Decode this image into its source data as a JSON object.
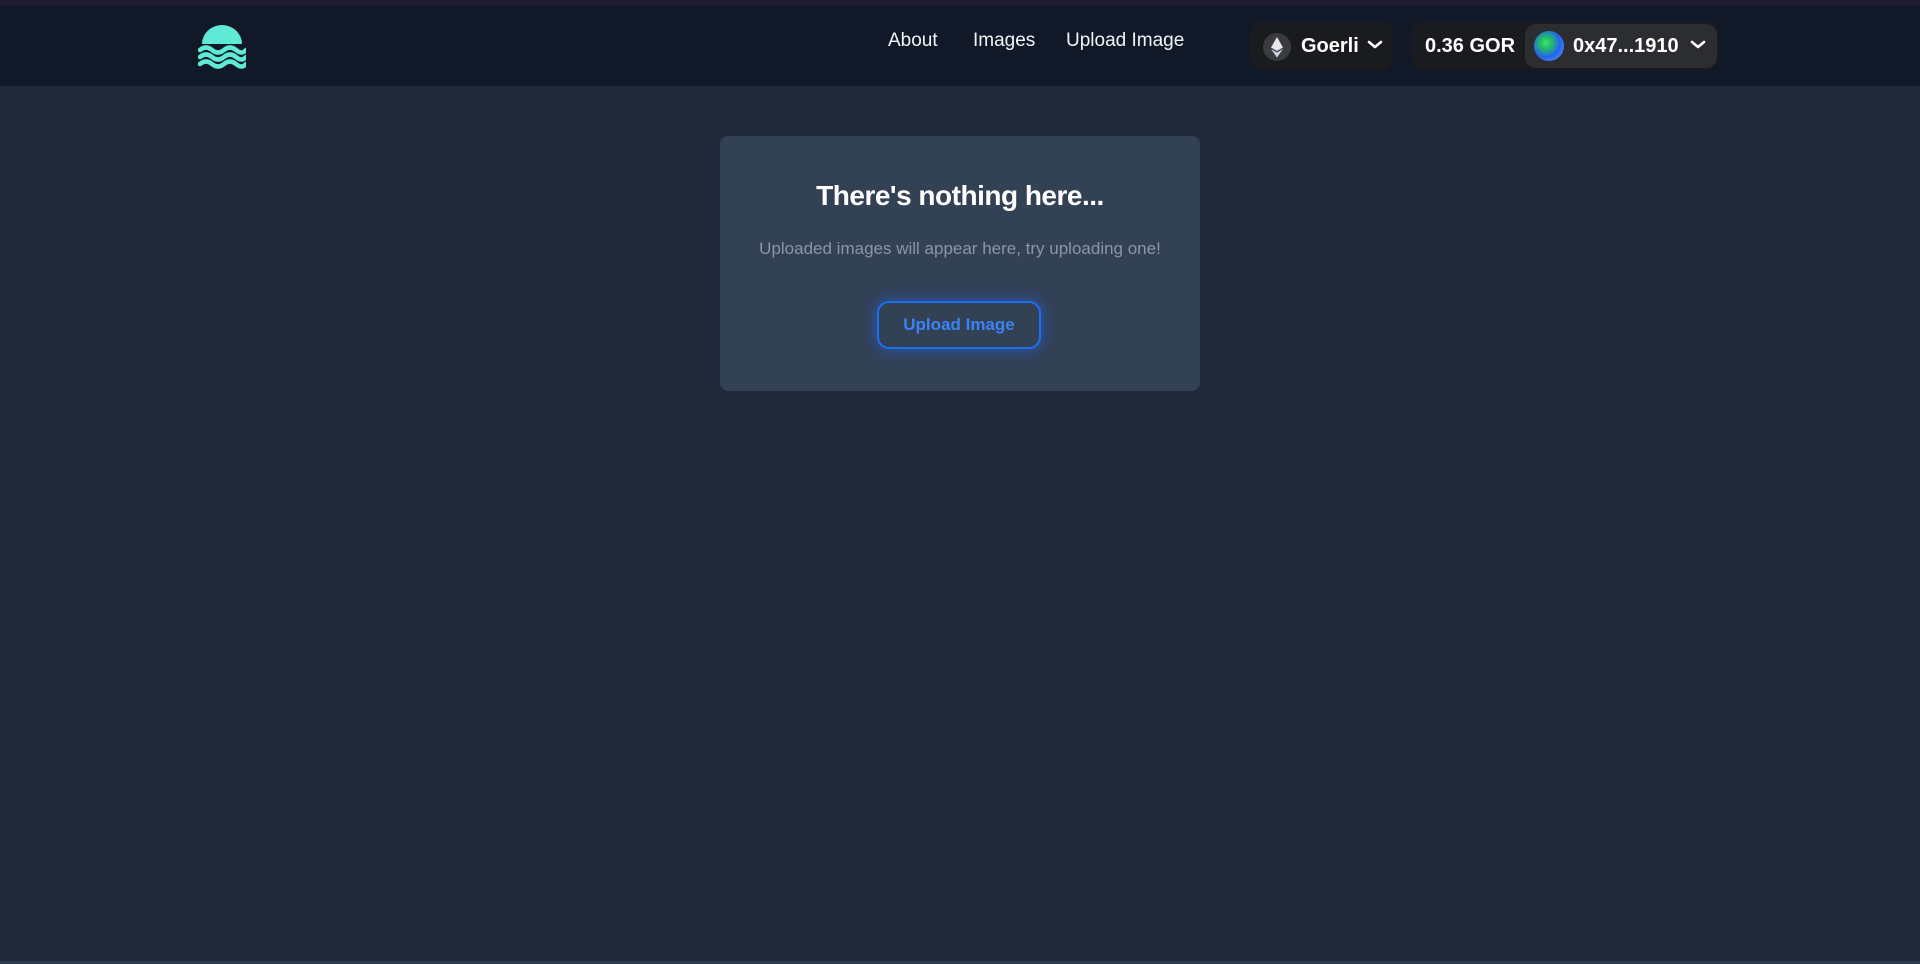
{
  "nav": {
    "logo_icon": "waves-sun-icon",
    "links": [
      {
        "label": "About"
      },
      {
        "label": "Images"
      },
      {
        "label": "Upload Image"
      }
    ]
  },
  "wallet": {
    "network": {
      "icon": "ethereum-icon",
      "label": "Goerli"
    },
    "balance": "0.36 GOR",
    "account": {
      "icon": "avatar",
      "address": "0x47...1910"
    }
  },
  "empty_state": {
    "title": "There's nothing here...",
    "subtitle": "Uploaded images will appear here, try uploading one!",
    "button_label": "Upload Image"
  },
  "colors": {
    "accent": "#5eead4",
    "button_blue": "#1d6ff2",
    "background": "#1f2937",
    "navbar": "#111827",
    "card": "#334155"
  }
}
